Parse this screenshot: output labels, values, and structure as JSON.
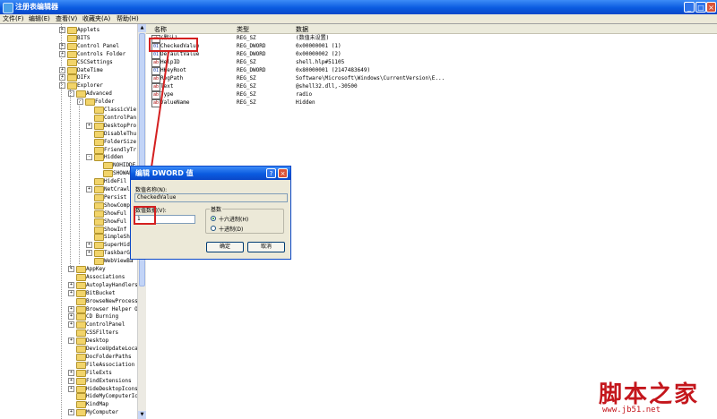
{
  "window": {
    "title": "注册表编辑器",
    "buttons": [
      "_",
      "□",
      "×"
    ]
  },
  "menu": [
    "文件(F)",
    "编辑(E)",
    "查看(V)",
    "收藏夹(A)",
    "帮助(H)"
  ],
  "tree": {
    "items": [
      {
        "label": "Applets",
        "depth": 0,
        "expander": "+"
      },
      {
        "label": "BITS",
        "depth": 0,
        "expander": ""
      },
      {
        "label": "Control Panel",
        "depth": 0,
        "expander": "+"
      },
      {
        "label": "Controls Folder",
        "depth": 0,
        "expander": "+"
      },
      {
        "label": "CSCSettings",
        "depth": 0,
        "expander": ""
      },
      {
        "label": "DateTime",
        "depth": 0,
        "expander": "+"
      },
      {
        "label": "DIFx",
        "depth": 0,
        "expander": "+"
      },
      {
        "label": "Explorer",
        "depth": 0,
        "expander": "-"
      },
      {
        "label": "Advanced",
        "depth": 1,
        "expander": "-"
      },
      {
        "label": "Folder",
        "depth": 2,
        "expander": "-"
      },
      {
        "label": "ClassicVie",
        "depth": 3,
        "expander": ""
      },
      {
        "label": "ControlPan",
        "depth": 3,
        "expander": ""
      },
      {
        "label": "DesktopPro",
        "depth": 3,
        "expander": "+"
      },
      {
        "label": "DisableThu",
        "depth": 3,
        "expander": ""
      },
      {
        "label": "FolderSize",
        "depth": 3,
        "expander": ""
      },
      {
        "label": "FriendlyTr",
        "depth": 3,
        "expander": ""
      },
      {
        "label": "Hidden",
        "depth": 3,
        "expander": "-"
      },
      {
        "label": "NOHIDDE",
        "depth": 4,
        "expander": ""
      },
      {
        "label": "SHOWALL",
        "depth": 4,
        "expander": ""
      },
      {
        "label": "HideFil",
        "depth": 3,
        "expander": ""
      },
      {
        "label": "NetCrawl",
        "depth": 3,
        "expander": "+"
      },
      {
        "label": "Persist",
        "depth": 3,
        "expander": ""
      },
      {
        "label": "ShowComp",
        "depth": 3,
        "expander": ""
      },
      {
        "label": "ShowFul",
        "depth": 3,
        "expander": ""
      },
      {
        "label": "ShowFul",
        "depth": 3,
        "expander": ""
      },
      {
        "label": "ShowInf",
        "depth": 3,
        "expander": ""
      },
      {
        "label": "SimpleSh",
        "depth": 3,
        "expander": ""
      },
      {
        "label": "SuperHid",
        "depth": 3,
        "expander": "+"
      },
      {
        "label": "TaskbarG",
        "depth": 3,
        "expander": "+"
      },
      {
        "label": "WebViewBa",
        "depth": 3,
        "expander": ""
      },
      {
        "label": "AppKey",
        "depth": 1,
        "expander": "+"
      },
      {
        "label": "Associations",
        "depth": 1,
        "expander": ""
      },
      {
        "label": "AutoplayHandlers",
        "depth": 1,
        "expander": "+"
      },
      {
        "label": "BitBucket",
        "depth": 1,
        "expander": "+"
      },
      {
        "label": "BrowseNewProcess",
        "depth": 1,
        "expander": ""
      },
      {
        "label": "Browser Helper O",
        "depth": 1,
        "expander": "+"
      },
      {
        "label": "CD Burning",
        "depth": 1,
        "expander": "+"
      },
      {
        "label": "ControlPanel",
        "depth": 1,
        "expander": "+"
      },
      {
        "label": "CSSFilters",
        "depth": 1,
        "expander": ""
      },
      {
        "label": "Desktop",
        "depth": 1,
        "expander": "+"
      },
      {
        "label": "DeviceUpdateLoca",
        "depth": 1,
        "expander": ""
      },
      {
        "label": "DocFolderPaths",
        "depth": 1,
        "expander": ""
      },
      {
        "label": "FileAssociation",
        "depth": 1,
        "expander": ""
      },
      {
        "label": "FileExts",
        "depth": 1,
        "expander": "+"
      },
      {
        "label": "FindExtensions",
        "depth": 1,
        "expander": "+"
      },
      {
        "label": "HideDesktopIcons",
        "depth": 1,
        "expander": "+"
      },
      {
        "label": "HideMyComputerIc",
        "depth": 1,
        "expander": ""
      },
      {
        "label": "KindMap",
        "depth": 1,
        "expander": ""
      },
      {
        "label": "MyComputer",
        "depth": 1,
        "expander": "+"
      }
    ]
  },
  "values": {
    "headers": [
      "名称",
      "类型",
      "数据"
    ],
    "rows": [
      {
        "name": "(默认)",
        "type": "REG_SZ",
        "data": "(数值未设置)"
      },
      {
        "name": "CheckedValue",
        "type": "REG_DWORD",
        "data": "0x00000001 (1)"
      },
      {
        "name": "DefaultValue",
        "type": "REG_DWORD",
        "data": "0x00000002 (2)"
      },
      {
        "name": "HelpID",
        "type": "REG_SZ",
        "data": "shell.hlp#51105"
      },
      {
        "name": "HKeyRoot",
        "type": "REG_DWORD",
        "data": "0x80000001 (2147483649)"
      },
      {
        "name": "RegPath",
        "type": "REG_SZ",
        "data": "Software\\Microsoft\\Windows\\CurrentVersion\\E..."
      },
      {
        "name": "Text",
        "type": "REG_SZ",
        "data": "@shell32.dll,-30500"
      },
      {
        "name": "Type",
        "type": "REG_SZ",
        "data": "radio"
      },
      {
        "name": "ValueName",
        "type": "REG_SZ",
        "data": "Hidden"
      }
    ]
  },
  "dialog": {
    "title": "编辑 DWORD 值",
    "name_label": "数值名称(N):",
    "name_value": "CheckedValue",
    "data_label": "数值数据(V):",
    "data_value": "1",
    "base_label": "基数",
    "hex_label": "十六进制(H)",
    "dec_label": "十进制(D)",
    "selected_base": "hex",
    "ok": "确定",
    "cancel": "取消",
    "help_btn": "?",
    "close_btn": "×"
  },
  "watermark": {
    "text": "脚本之家",
    "url": "www.jb51.net"
  },
  "colors": {
    "accent": "#0a5be0",
    "highlight": "#d42020",
    "watermark": "#c4161c"
  }
}
